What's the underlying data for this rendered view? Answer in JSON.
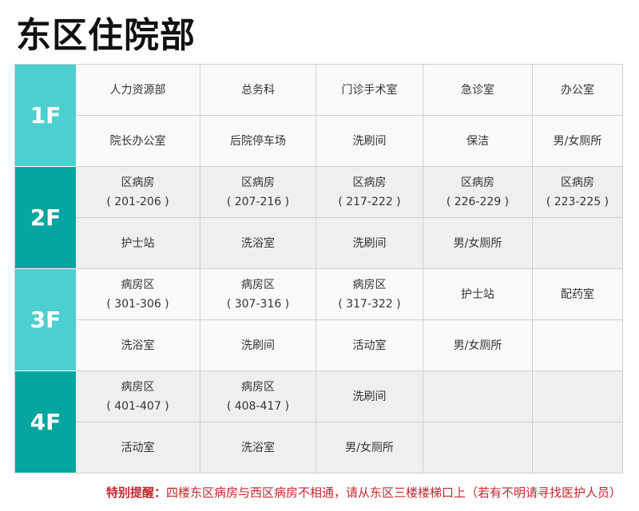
{
  "title": "东区住院部",
  "colors": {
    "floor_light": "#4ecfcf",
    "floor_dark": "#06a5a0",
    "notice": "#c0272d"
  },
  "floors": [
    {
      "label": "1F",
      "rows": [
        [
          "人力资源部",
          "总务科",
          "门诊手术室",
          "急诊室",
          "办公室"
        ],
        [
          "院长办公室",
          "后院停车场",
          "洗刷间",
          "保洁",
          "男/女厕所"
        ]
      ]
    },
    {
      "label": "2F",
      "rows": [
        [
          "区病房\n( 201-206 )",
          "区病房\n( 207-216 )",
          "区病房\n( 217-222 )",
          "区病房\n( 226-229 )",
          "区病房\n( 223-225 )"
        ],
        [
          "护士站",
          "洗浴室",
          "洗刷间",
          "男/女厕所",
          ""
        ]
      ]
    },
    {
      "label": "3F",
      "rows": [
        [
          "病房区\n( 301-306 )",
          "病房区\n( 307-316 )",
          "病房区\n( 317-322 )",
          "护士站",
          "配药室"
        ],
        [
          "洗浴室",
          "洗刷间",
          "活动室",
          "男/女厕所",
          ""
        ]
      ]
    },
    {
      "label": "4F",
      "rows": [
        [
          "病房区\n( 401-407 )",
          "病房区\n( 408-417 )",
          "洗刷间",
          "",
          ""
        ],
        [
          "活动室",
          "洗浴室",
          "男/女厕所",
          "",
          ""
        ]
      ]
    }
  ],
  "notice": {
    "label": "特别提醒：",
    "text": "四楼东区病房与西区病房不相通，请从东区三楼楼梯口上（若有不明请寻找医护人员）"
  }
}
